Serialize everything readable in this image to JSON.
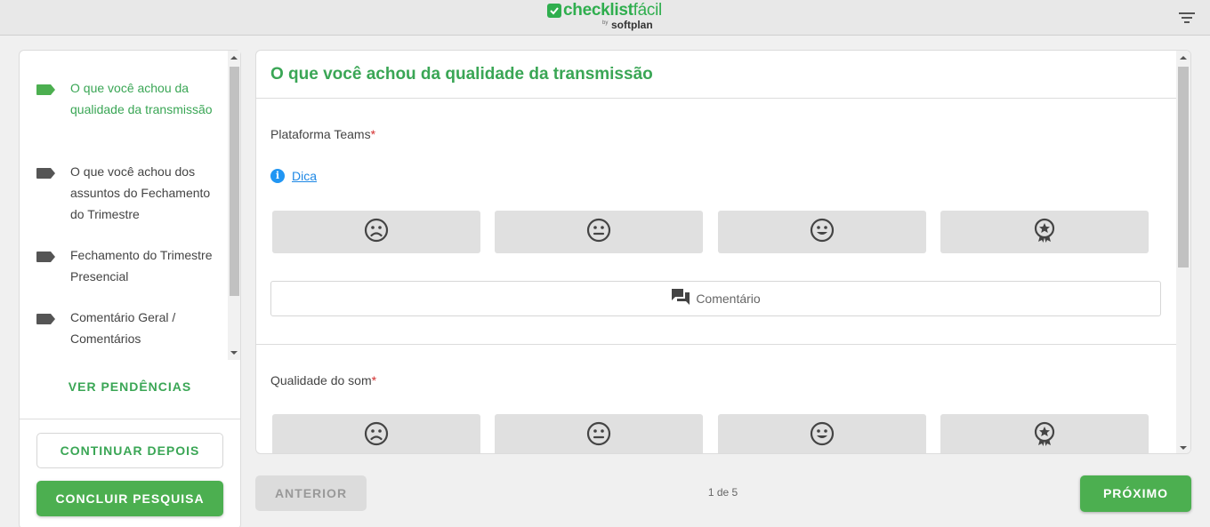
{
  "header": {
    "logo_main": "checklist",
    "logo_light": "fácil",
    "logo_by": "by",
    "logo_sub": "softplan"
  },
  "sidebar": {
    "items": [
      {
        "label": "O que você achou da qualidade da transmissão",
        "active": true
      },
      {
        "label": "O que você achou dos assuntos do Fechamento do Trimestre",
        "active": false
      },
      {
        "label": "Fechamento do Trimestre Presencial",
        "active": false
      },
      {
        "label": "Comentário Geral / Comentários",
        "active": false
      }
    ],
    "pending_label": "VER PENDÊNCIAS",
    "continue_label": "CONTINUAR DEPOIS",
    "finish_label": "CONCLUIR PESQUISA"
  },
  "main": {
    "title": "O que você achou da qualidade da transmissão",
    "questions": [
      {
        "label": "Plataforma Teams",
        "required_mark": "*",
        "tip_label": "Dica",
        "options": [
          "sad-face-icon",
          "neutral-face-icon",
          "happy-face-icon",
          "star-badge-icon"
        ],
        "comment_label": "Comentário"
      },
      {
        "label": "Qualidade do som",
        "required_mark": "*",
        "options": [
          "sad-face-icon",
          "neutral-face-icon",
          "happy-face-icon",
          "star-badge-icon"
        ]
      }
    ]
  },
  "footer": {
    "prev_label": "ANTERIOR",
    "pager": "1 de 5",
    "next_label": "PRÓXIMO"
  },
  "colors": {
    "brand_green": "#3aa655",
    "button_green": "#4caf50",
    "required_red": "#d32f2f",
    "tip_blue": "#2196f3"
  }
}
